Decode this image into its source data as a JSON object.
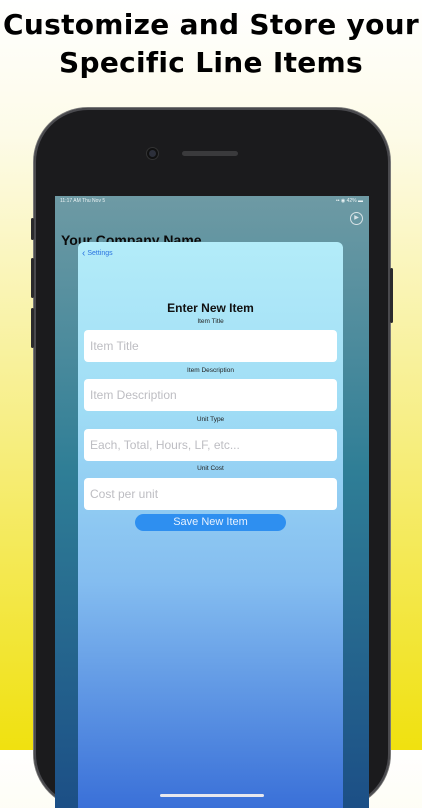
{
  "headline": {
    "line1": "Customize and Store your",
    "line2": "Specific Line Items"
  },
  "status_bar": {
    "time_date": "11:17 AM   Thu Nov 5",
    "right": "••  ◉ 42% ▬"
  },
  "background_screen": {
    "company_name": "Your Company Name",
    "corner_icon": "play-circle-icon"
  },
  "sheet": {
    "back_label": "Settings",
    "title": "Enter New Item",
    "fields": [
      {
        "label": "Item Title",
        "placeholder": "Item Title",
        "value": ""
      },
      {
        "label": "Item Description",
        "placeholder": "Item Description",
        "value": ""
      },
      {
        "label": "Unit Type",
        "placeholder": "Each, Total, Hours, LF, etc...",
        "value": ""
      },
      {
        "label": "Unit Cost",
        "placeholder": "Cost per unit",
        "value": ""
      }
    ],
    "save_label": "Save New Item"
  },
  "colors": {
    "accent": "#2e8ff0",
    "back_link": "#2a73e0",
    "page_yellow": "#f0e10f"
  }
}
